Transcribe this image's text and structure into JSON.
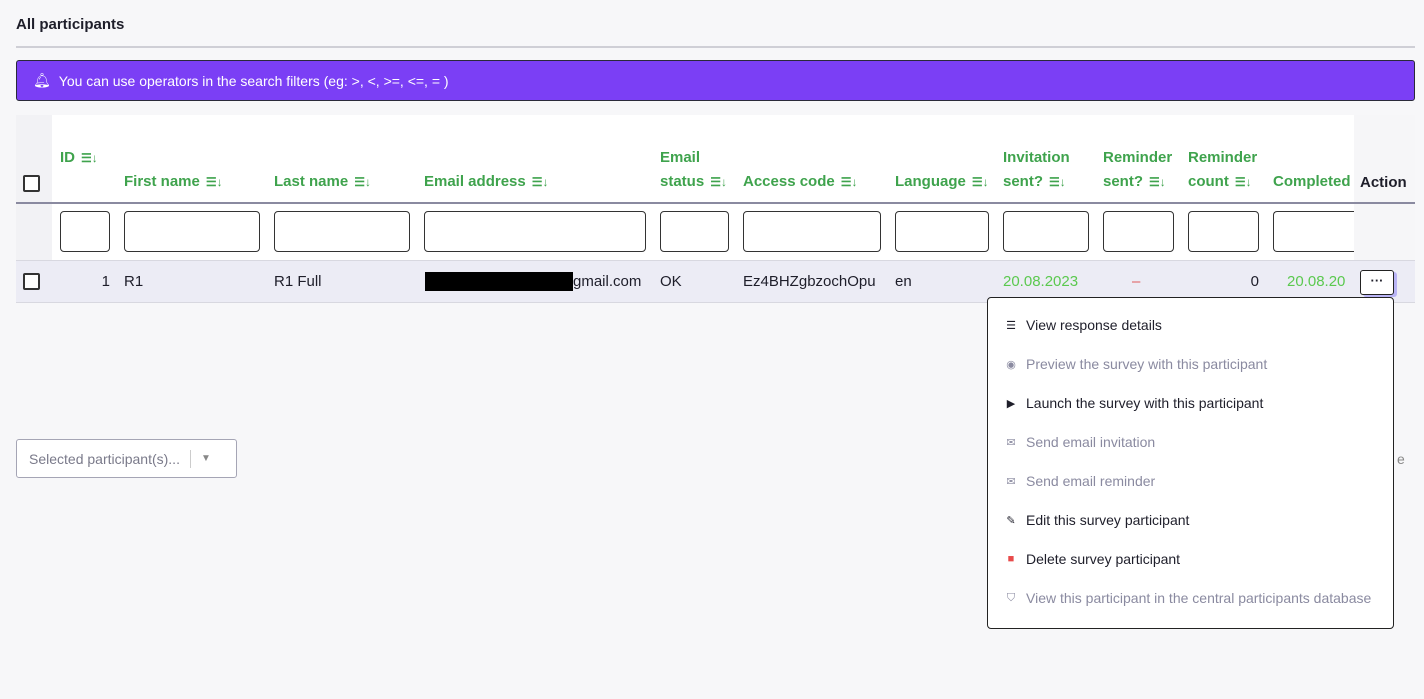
{
  "title": "All participants",
  "alert": {
    "text": "You can use operators in the search filters (eg: >, <, >=, <=, = )",
    "color": "#7b3ff5"
  },
  "columns": [
    {
      "l1": "",
      "l2": "ID"
    },
    {
      "l1": "",
      "l2": "First name"
    },
    {
      "l1": "",
      "l2": "Last name"
    },
    {
      "l1": "",
      "l2": "Email address"
    },
    {
      "l1": "Email",
      "l2": "status"
    },
    {
      "l1": "",
      "l2": "Access code"
    },
    {
      "l1": "",
      "l2": "Language"
    },
    {
      "l1": "Invitation",
      "l2": "sent?"
    },
    {
      "l1": "Reminder",
      "l2": "sent?"
    },
    {
      "l1": "Reminder",
      "l2": "count"
    },
    {
      "l1": "",
      "l2": "Completed"
    }
  ],
  "action_header": "Action",
  "row": {
    "id": "1",
    "first": "R1",
    "last": "R1 Full",
    "email_suffix": "gmail.com",
    "email_status": "OK",
    "access": "Ez4BHZgbzochOpu",
    "language": "en",
    "invitation": "20.08.2023",
    "reminder": "–",
    "count": "0",
    "completed": "20.08.20",
    "action": "···"
  },
  "menu": [
    {
      "label": "View response details",
      "icon": "list-icon",
      "disabled": false
    },
    {
      "label": "Preview the survey with this participant",
      "icon": "eye-icon",
      "disabled": true
    },
    {
      "label": "Launch the survey with this participant",
      "icon": "play-icon",
      "disabled": false
    },
    {
      "label": "Send email invitation",
      "icon": "mail-send-icon",
      "disabled": true
    },
    {
      "label": "Send email reminder",
      "icon": "mail-send-icon",
      "disabled": true
    },
    {
      "label": "Edit this survey participant",
      "icon": "pencil-icon",
      "disabled": false
    },
    {
      "label": "Delete survey participant",
      "icon": "trash-icon",
      "disabled": false
    },
    {
      "label": "View this participant in the central participants database",
      "icon": "shield-user-icon",
      "disabled": true
    }
  ],
  "selected_dropdown": "Selected participant(s)...",
  "partial_text": "e"
}
